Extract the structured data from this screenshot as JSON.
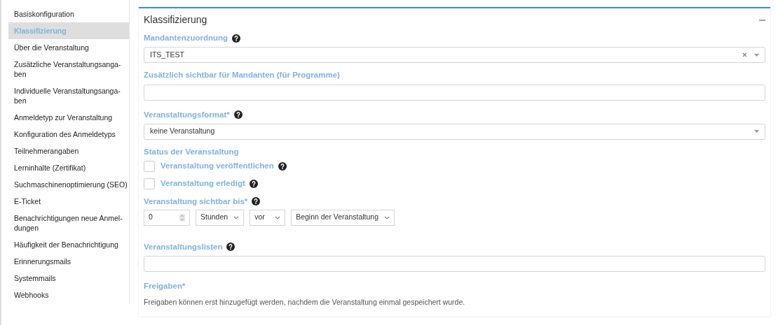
{
  "sidebar": {
    "items": [
      {
        "label": "Basiskonfiguration",
        "selected": false
      },
      {
        "label": "Klassifizierung",
        "selected": true
      },
      {
        "label": "Über die Veranstaltung",
        "selected": false
      },
      {
        "label": "Zusätzliche Veranstaltungsanga-\nben",
        "selected": false
      },
      {
        "label": "Individuelle Veranstaltungsanga-\nben",
        "selected": false
      },
      {
        "label": "Anmeldetyp zur Veranstaltung",
        "selected": false
      },
      {
        "label": "Konfiguration des Anmeldetyps",
        "selected": false
      },
      {
        "label": "Teilnehmerangaben",
        "selected": false
      },
      {
        "label": "Lerninhalte (Zertifikat)",
        "selected": false
      },
      {
        "label": "Suchmaschinenoptimierung (SEO)",
        "selected": false
      },
      {
        "label": "E-Ticket",
        "selected": false
      },
      {
        "label": "Benachrichtigungen neue Anmel-\ndungen",
        "selected": false
      },
      {
        "label": "Häufigkeit der Benachrichtigung",
        "selected": false
      },
      {
        "label": "Erinnerungsmails",
        "selected": false
      },
      {
        "label": "Systemmails",
        "selected": false
      },
      {
        "label": "Webhooks",
        "selected": false
      }
    ]
  },
  "panel": {
    "title": "Klassifizierung",
    "expanded": true,
    "fields": [
      {
        "kind": "select",
        "label": "Mandantenzuordnung",
        "help": true,
        "value": "ITS_TEST",
        "clearable": true
      },
      {
        "kind": "input",
        "label": "Zusätzlich sichtbar für Mandanten (für Programme)",
        "help": false
      },
      {
        "kind": "select",
        "label": "Veranstaltungsformat*",
        "help": true,
        "value": "keine Veranstaltung",
        "clearable": false
      },
      {
        "kind": "heading",
        "label": "Status der Veranstaltung"
      },
      {
        "kind": "checkbox",
        "label": "Veranstaltung veröffentlichen",
        "help": true,
        "checked": false
      },
      {
        "kind": "checkbox",
        "label": "Veranstaltung erledigt",
        "help": true,
        "checked": false
      },
      {
        "kind": "offset",
        "label": "Veranstaltung sichtbar bis*",
        "help": true,
        "number": "0",
        "unit": "Stunden",
        "direction": "vor",
        "reference": "Beginn der Veranstaltung"
      },
      {
        "kind": "input",
        "label": "Veranstaltungslisten",
        "help": true
      },
      {
        "kind": "note",
        "label": "Freigaben*",
        "text": "Freigaben können erst hinzugefügt werden, nachdem die Veranstaltung einmal gespeichert wurde."
      }
    ]
  }
}
